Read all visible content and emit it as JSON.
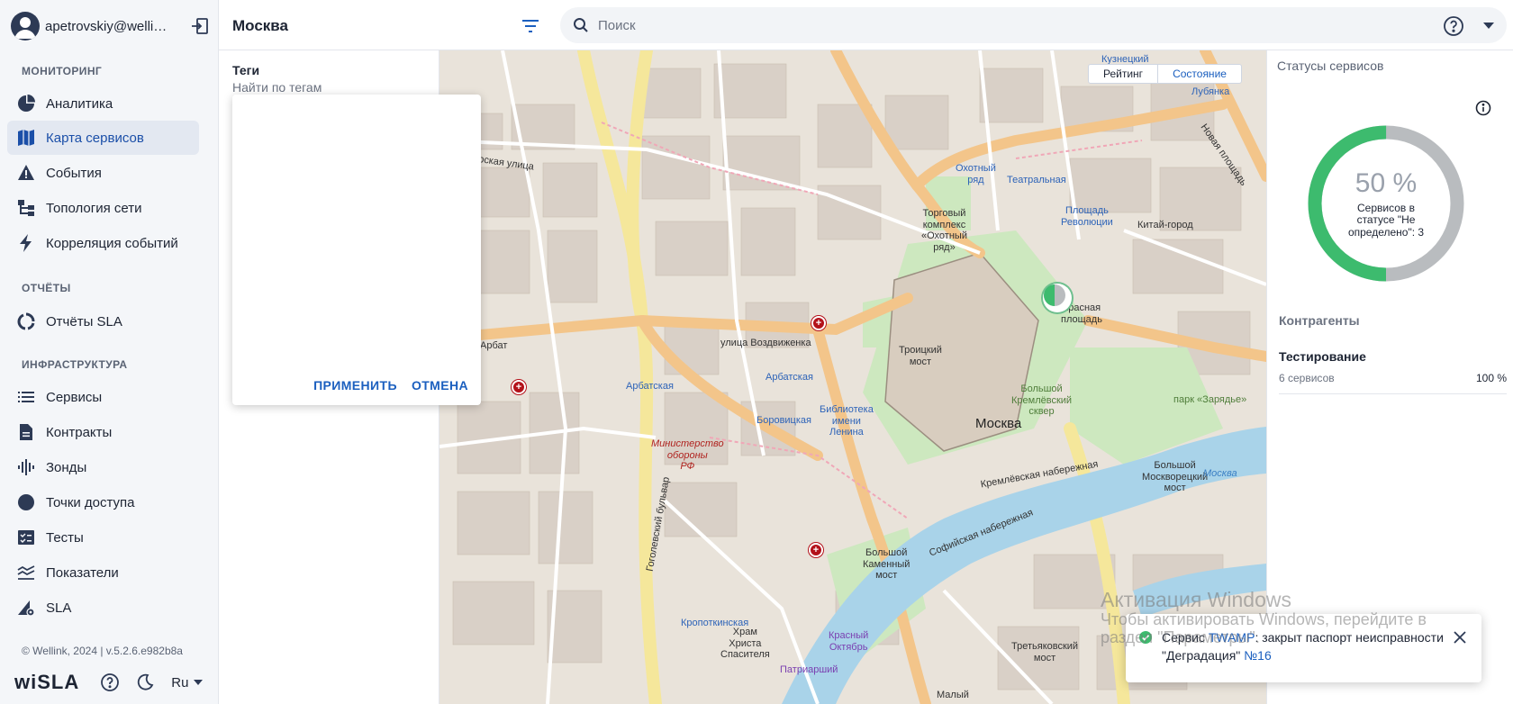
{
  "user": {
    "email": "apetrovskiy@wellin..."
  },
  "nav": {
    "sections": {
      "monitoring": "МОНИТОРИНГ",
      "reports": "ОТЧЁТЫ",
      "infrastructure": "ИНФРАСТРУКТУРА"
    },
    "items": {
      "analytics": "Аналитика",
      "service_map": "Карта сервисов",
      "events": "События",
      "topology": "Топология сети",
      "correlation": "Корреляция событий",
      "sla_reports": "Отчёты SLA",
      "services": "Сервисы",
      "contracts": "Контракты",
      "probes": "Зонды",
      "access_points": "Точки доступа",
      "tests": "Тесты",
      "metrics": "Показатели",
      "sla": "SLA"
    }
  },
  "footer": {
    "copyright": "© Wellink, 2024 | v.5.2.6.e982b8a",
    "logo": "wiSLA",
    "language": "Ru"
  },
  "header": {
    "city": "Москва",
    "search_placeholder": "Поиск"
  },
  "tags": {
    "title": "Теги",
    "search_placeholder": "Найти по тегам",
    "apply_label": "ПРИМЕНИТЬ",
    "cancel_label": "ОТМЕНА"
  },
  "map": {
    "toggle": {
      "rating": "Рейтинг",
      "state": "Состояние"
    },
    "labels": {
      "kuznetsky": "Кузнецкий\nмост",
      "lubyanka": "Лубянка",
      "okhotny": "Охотный\nряд",
      "teatralnaya": "Театральная",
      "revolution": "Площадь\nРеволюции",
      "kitay": "Китай-город",
      "tk_okhotny": "Торговый\nкомплекс\n«Охотный\nряд»",
      "red_square": "Красная\nплощадь",
      "vozdvizhenka": "улица Воздвиженка",
      "arbat": "Арбат",
      "arbatskaya": "Арбатская",
      "borovitskaya": "Боровицкая",
      "library": "Библиотека\nимени\nЛенина",
      "troitsky": "Троицкий\nмост",
      "moskva": "Москва",
      "ministry": "Министерство\nобороны\nРФ",
      "kremlin_square": "Большой\nКремлёвский\nсквер",
      "zaryadye": "парк «Зарядье»",
      "moskvoretsky": "Большой\nМоскворецкий\nмост",
      "kremlevskaya_nab": "Кремлёвская набережная",
      "kamenny": "Большой\nКаменный\nмост",
      "sofiyskaya": "Софийская набережная",
      "kropotkinskaya": "Кропоткинская",
      "cathedral": "Храм\nХриста\nСпасителя",
      "krasny_oktyabr": "Красный\nОктябрь",
      "patriarshiy": "Патриарший",
      "tretyakovsky": "Третьяковский\nмост",
      "maly": "Малый",
      "moskva_river": "Москва",
      "tverskaya": "Тверская улица",
      "gogolevsky": "Гоголевский бульвар",
      "novaya_ploshchad": "Новая площадь"
    }
  },
  "status_panel": {
    "title": "Статусы сервисов",
    "percent": "50 %",
    "caption": "Сервисов в статусе \"Не определено\": 3",
    "value_fraction": 0.5,
    "colors": {
      "green": "#3dbb6e",
      "gray": "#b9bcbf"
    }
  },
  "counterparties": {
    "title": "Контрагенты",
    "items": [
      {
        "name": "Тестирование",
        "services": "6 сервисов",
        "percent": "100 %"
      }
    ]
  },
  "watermark": {
    "line1": "Активация Windows",
    "line2": "Чтобы активировать Windows, перейдите в",
    "line3": "раздел \"Параметры\"."
  },
  "toast": {
    "prefix": "Сервис ",
    "service": "TWAMP",
    "middle": ": закрыт паспорт неисправности \"Деградация\" ",
    "ticket": "№16"
  },
  "colors": {
    "accent": "#1b5fbf",
    "sidebar_bg": "#f4f6f9",
    "active_item_bg": "#e3e8f1"
  }
}
